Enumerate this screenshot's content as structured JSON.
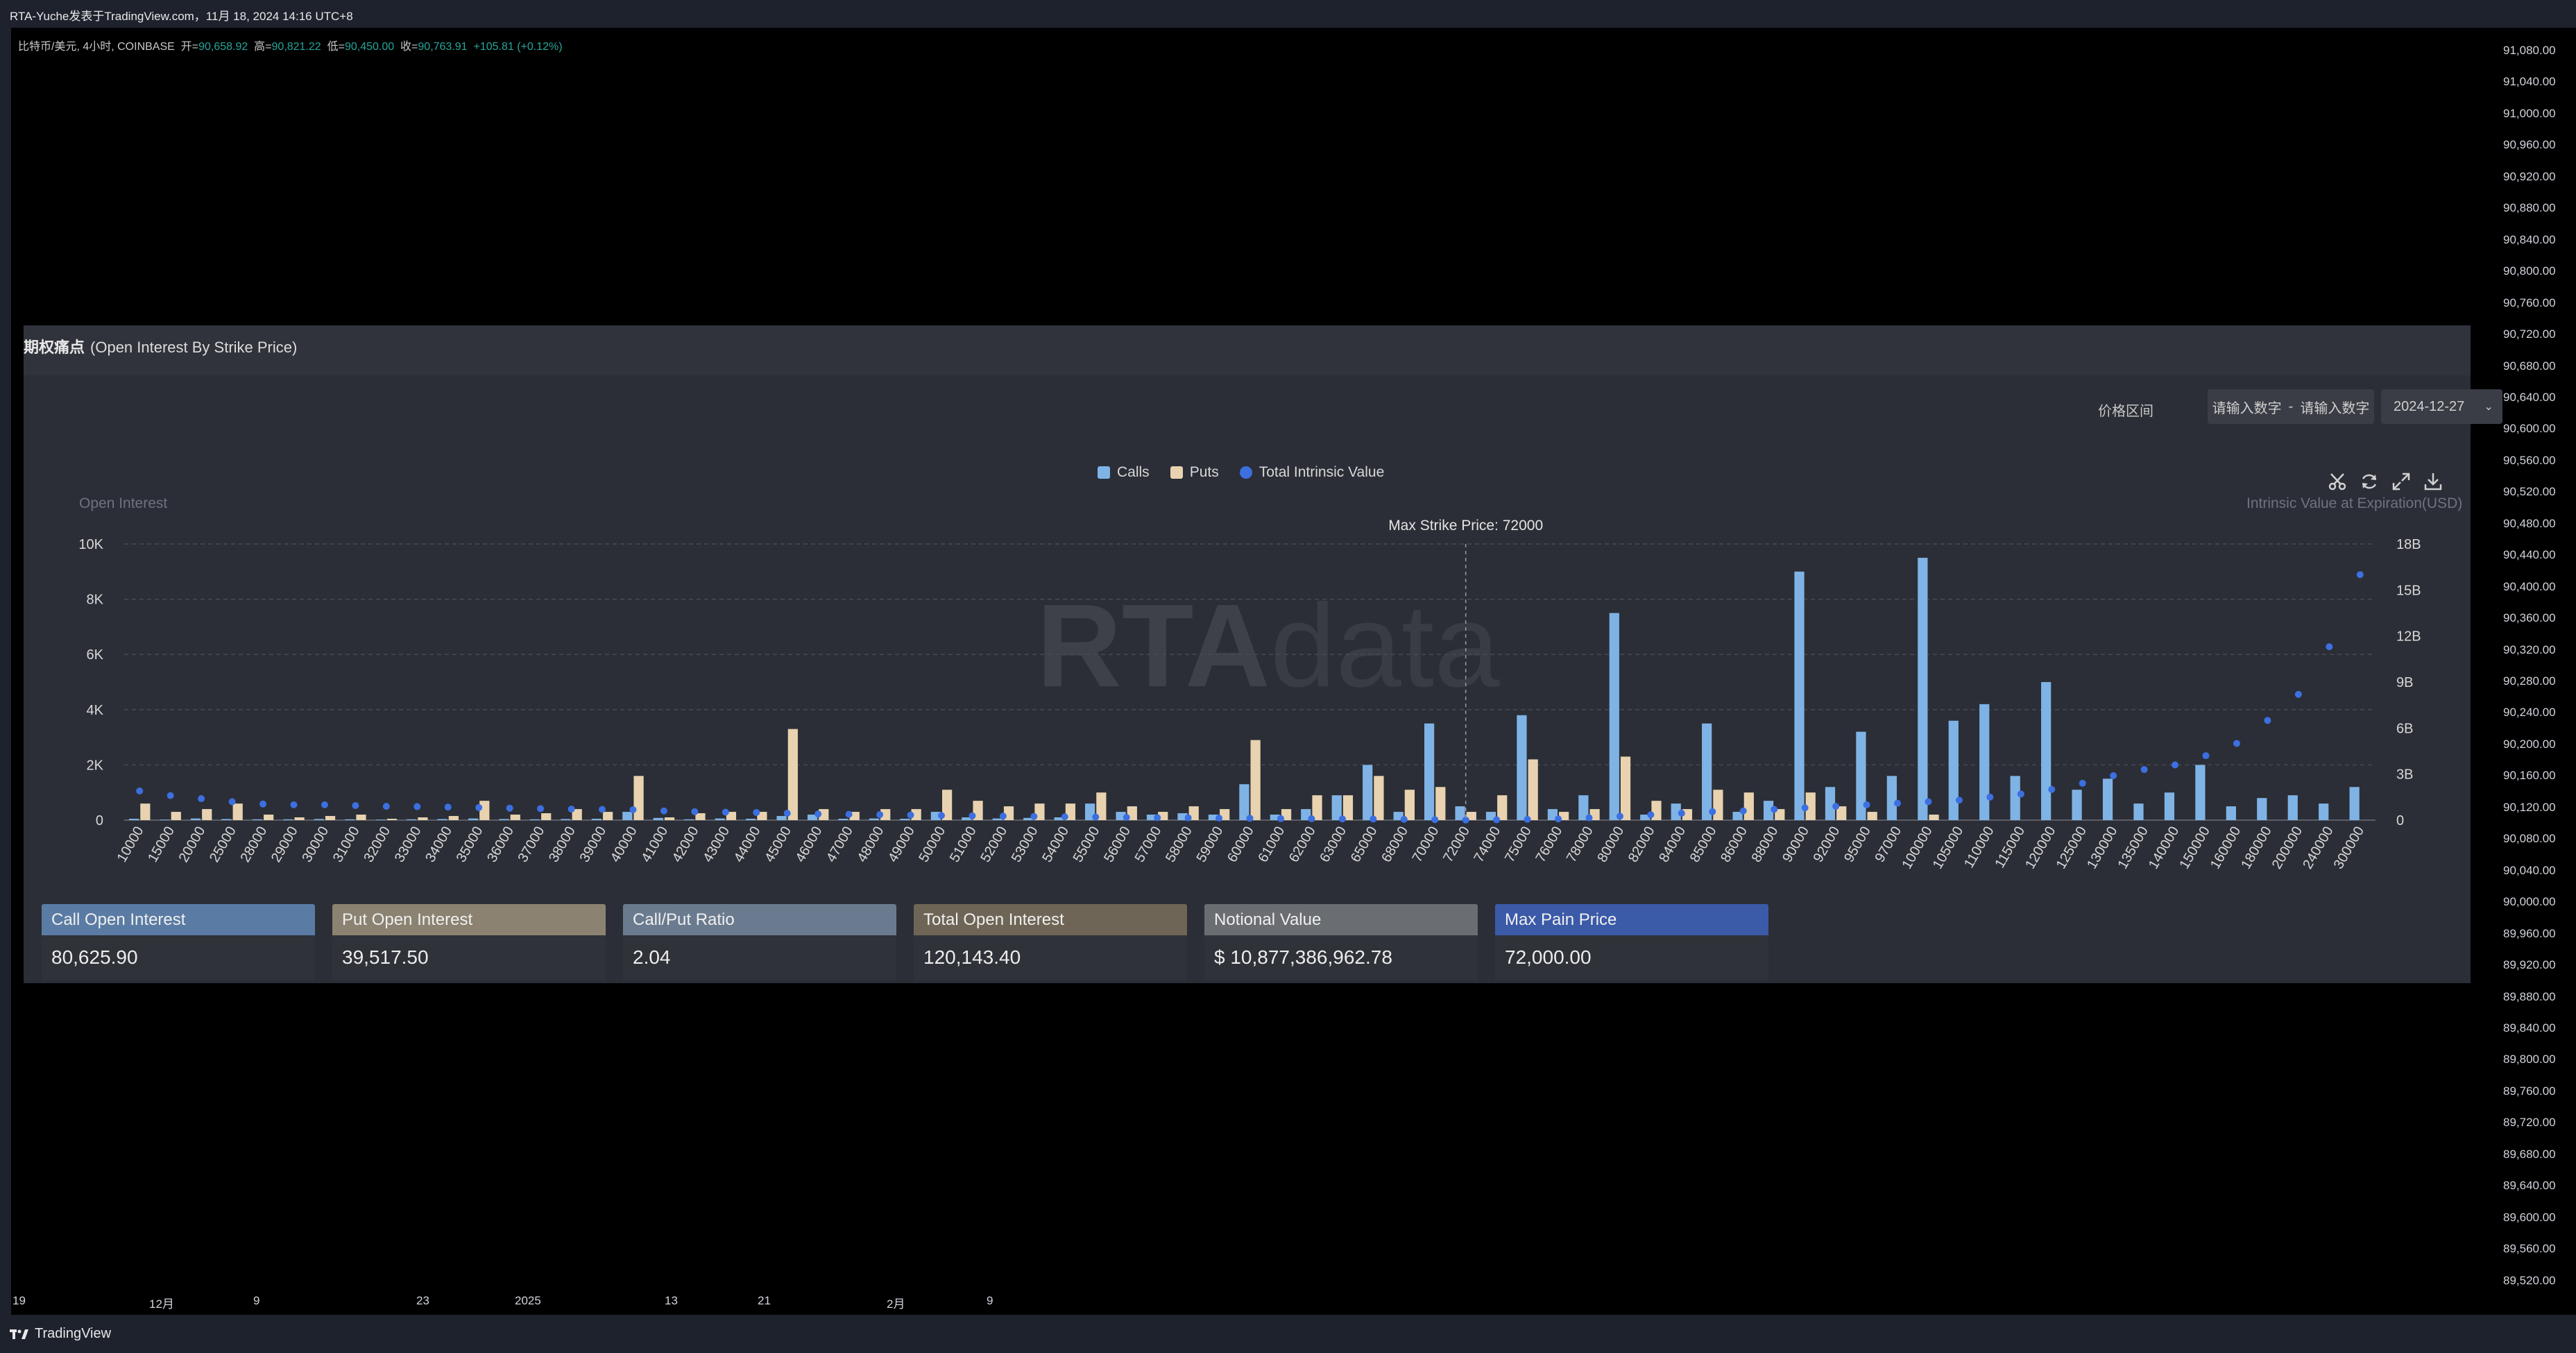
{
  "window": {
    "title": "RTA-Yuche发表于TradingView.com，11月 18, 2024 14:16 UTC+8"
  },
  "legend": {
    "symbol": "比特币/美元, 4小时, COINBASE",
    "open_label": "开=",
    "open": "90,658.92",
    "high_label": "高=",
    "high": "90,821.22",
    "low_label": "低=",
    "low": "90,450.00",
    "close_label": "收=",
    "close": "90,763.91",
    "change": "+105.81 (+0.12%)"
  },
  "price_axis": [
    "91,080.00",
    "91,040.00",
    "91,000.00",
    "90,960.00",
    "90,920.00",
    "90,880.00",
    "90,840.00",
    "90,800.00",
    "90,760.00",
    "90,720.00",
    "90,680.00",
    "90,640.00",
    "90,600.00",
    "90,560.00",
    "90,520.00",
    "90,480.00",
    "90,440.00",
    "90,400.00",
    "90,360.00",
    "90,320.00",
    "90,280.00",
    "90,240.00",
    "90,200.00",
    "90,160.00",
    "90,120.00",
    "90,080.00",
    "90,040.00",
    "90,000.00",
    "89,960.00",
    "89,920.00",
    "89,880.00",
    "89,840.00",
    "89,800.00",
    "89,760.00",
    "89,720.00",
    "89,680.00",
    "89,640.00",
    "89,600.00",
    "89,560.00",
    "89,520.00"
  ],
  "time_axis": [
    "19",
    "12月",
    "9",
    "23",
    "2025",
    "13",
    "21",
    "2月",
    "9"
  ],
  "footer": {
    "brand": "TradingView"
  },
  "panel": {
    "title": "期权痛点",
    "subtitle": "(Open Interest By Strike Price)",
    "range_label": "价格区间",
    "range_from_placeholder": "请输入数字",
    "range_sep": "-",
    "range_to_placeholder": "请输入数字",
    "expiry": "2024-12-27",
    "legend_calls": "Calls",
    "legend_puts": "Puts",
    "legend_intrinsic": "Total Intrinsic Value",
    "y_left_title": "Open Interest",
    "y_right_title": "Intrinsic Value at Expiration(USD)",
    "watermark_a": "RTA",
    "watermark_b": "data"
  },
  "chart_data": {
    "type": "bar",
    "title": "Max Strike Price:  72000",
    "max_strike": "72000",
    "categories": [
      "10000",
      "15000",
      "20000",
      "25000",
      "28000",
      "29000",
      "30000",
      "31000",
      "32000",
      "33000",
      "34000",
      "35000",
      "36000",
      "37000",
      "38000",
      "39000",
      "40000",
      "41000",
      "42000",
      "43000",
      "44000",
      "45000",
      "46000",
      "47000",
      "48000",
      "49000",
      "50000",
      "51000",
      "52000",
      "53000",
      "54000",
      "55000",
      "56000",
      "57000",
      "58000",
      "59000",
      "60000",
      "61000",
      "62000",
      "63000",
      "65000",
      "68000",
      "70000",
      "72000",
      "74000",
      "75000",
      "76000",
      "78000",
      "80000",
      "82000",
      "84000",
      "85000",
      "86000",
      "88000",
      "90000",
      "92000",
      "95000",
      "97000",
      "100000",
      "105000",
      "110000",
      "115000",
      "120000",
      "125000",
      "130000",
      "135000",
      "140000",
      "150000",
      "160000",
      "180000",
      "200000",
      "240000",
      "300000"
    ],
    "series": [
      {
        "name": "Calls",
        "values": [
          50,
          20,
          60,
          40,
          30,
          30,
          40,
          30,
          20,
          30,
          40,
          60,
          40,
          30,
          40,
          50,
          300,
          80,
          30,
          60,
          50,
          150,
          200,
          50,
          60,
          50,
          300,
          100,
          60,
          80,
          100,
          600,
          300,
          200,
          250,
          200,
          1300,
          200,
          400,
          900,
          2000,
          300,
          3500,
          500,
          300,
          3800,
          400,
          900,
          7500,
          200,
          600,
          3500,
          300,
          700,
          9000,
          1200,
          3200,
          1600,
          9500,
          3600,
          4200,
          1600,
          5000,
          1100,
          1500,
          600,
          1000,
          2000,
          500,
          800,
          900,
          600,
          1200
        ]
      },
      {
        "name": "Puts",
        "values": [
          600,
          300,
          400,
          600,
          200,
          100,
          150,
          200,
          50,
          100,
          150,
          700,
          200,
          250,
          400,
          300,
          1600,
          100,
          250,
          300,
          300,
          3300,
          400,
          300,
          400,
          400,
          1100,
          700,
          500,
          600,
          600,
          1000,
          500,
          300,
          500,
          400,
          2900,
          400,
          900,
          900,
          1600,
          1100,
          1200,
          300,
          900,
          2200,
          300,
          400,
          2300,
          700,
          400,
          1100,
          1000,
          400,
          1000,
          500,
          300,
          0,
          200,
          0,
          0,
          0,
          0,
          0,
          0,
          0,
          0,
          0,
          0,
          0,
          0,
          0,
          0
        ]
      },
      {
        "name": "Total Intrinsic Value",
        "values": [
          1.9,
          1.6,
          1.4,
          1.2,
          1.05,
          1.0,
          1.0,
          0.95,
          0.9,
          0.88,
          0.85,
          0.82,
          0.78,
          0.75,
          0.72,
          0.7,
          0.68,
          0.6,
          0.55,
          0.52,
          0.5,
          0.45,
          0.4,
          0.38,
          0.36,
          0.33,
          0.3,
          0.28,
          0.26,
          0.24,
          0.22,
          0.2,
          0.18,
          0.16,
          0.15,
          0.13,
          0.12,
          0.1,
          0.09,
          0.08,
          0.07,
          0.05,
          0.03,
          0.01,
          0.02,
          0.05,
          0.08,
          0.15,
          0.25,
          0.35,
          0.45,
          0.55,
          0.6,
          0.7,
          0.8,
          0.9,
          1.0,
          1.1,
          1.2,
          1.3,
          1.5,
          1.7,
          2.0,
          2.4,
          2.9,
          3.3,
          3.6,
          4.2,
          5.0,
          6.5,
          8.2,
          11.3,
          16.0
        ]
      }
    ],
    "y_left_ticks": [
      "10K",
      "8K",
      "6K",
      "4K",
      "2K",
      "0"
    ],
    "y_right_ticks": [
      "18B",
      "15B",
      "12B",
      "9B",
      "6B",
      "3B",
      "0"
    ],
    "ylim_left": [
      0,
      10000
    ],
    "ylim_right": [
      0,
      18
    ],
    "grid": true,
    "legend_position": "top-center",
    "colors": {
      "calls": "#7fb3e6",
      "puts": "#e8d2b0",
      "intrinsic": "#3c6fe0"
    }
  },
  "stats": [
    {
      "label": "Call Open Interest",
      "value": "80,625.90",
      "color": "#5a7ba3"
    },
    {
      "label": "Put Open Interest",
      "value": "39,517.50",
      "color": "#8b8271"
    },
    {
      "label": "Call/Put Ratio",
      "value": "2.04",
      "color": "#6b7b8f"
    },
    {
      "label": "Total Open Interest",
      "value": "120,143.40",
      "color": "#6e6556"
    },
    {
      "label": "Notional Value",
      "value": "$ 10,877,386,962.78",
      "color": "#6a6d72"
    },
    {
      "label": "Max Pain Price",
      "value": "72,000.00",
      "color": "#3b5aa8"
    }
  ]
}
